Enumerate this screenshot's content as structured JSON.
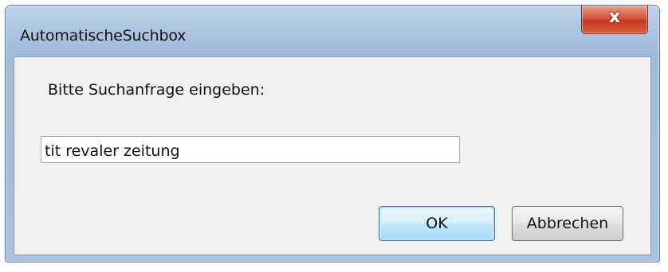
{
  "window": {
    "title": "AutomatischeSuchbox",
    "close_label": "x"
  },
  "dialog": {
    "prompt": "Bitte Suchanfrage eingeben:",
    "input_value": "tit revaler zeitung",
    "ok_label": "OK",
    "cancel_label": "Abbrechen"
  },
  "colors": {
    "frame_accent": "#a9c2df",
    "close_button": "#c23a1f",
    "default_button_border": "#3c7fb1"
  },
  "icons": {
    "close": "close-icon"
  }
}
